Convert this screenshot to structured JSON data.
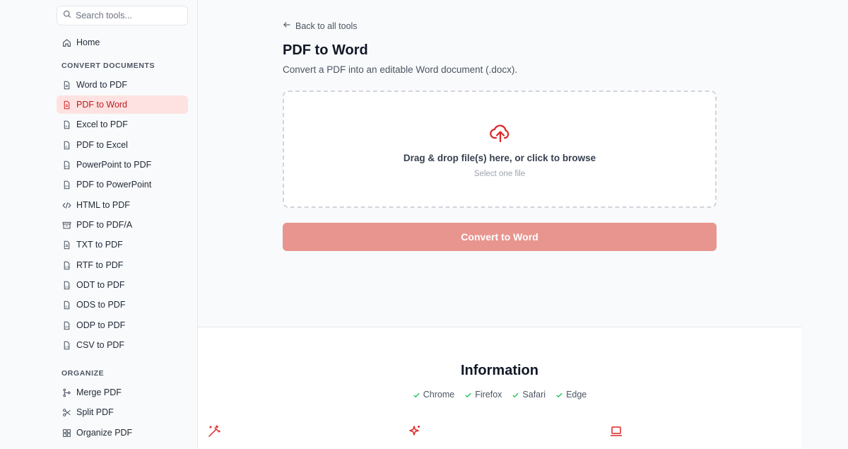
{
  "search": {
    "placeholder": "Search tools..."
  },
  "sidebar": {
    "home": "Home",
    "convert_section": "CONVERT DOCUMENTS",
    "convert_items": [
      "Word to PDF",
      "PDF to Word",
      "Excel to PDF",
      "PDF to Excel",
      "PowerPoint to PDF",
      "PDF to PowerPoint",
      "HTML to PDF",
      "PDF to PDF/A",
      "TXT to PDF",
      "RTF to PDF",
      "ODT to PDF",
      "ODS to PDF",
      "ODP to PDF",
      "CSV to PDF"
    ],
    "organize_section": "ORGANIZE",
    "organize_items": [
      "Merge PDF",
      "Split PDF",
      "Organize PDF"
    ]
  },
  "main": {
    "back": "Back to all tools",
    "title": "PDF to Word",
    "subtitle": "Convert a PDF into an editable Word document (.docx).",
    "drop_text": "Drag & drop file(s) here, or click to browse",
    "drop_hint": "Select one file",
    "convert_label": "Convert to Word"
  },
  "info": {
    "title": "Information",
    "browsers": [
      "Chrome",
      "Firefox",
      "Safari",
      "Edge"
    ]
  },
  "colors": {
    "accent": "#dc2626",
    "active_bg": "#fee2e2",
    "button_disabled": "#e8958f",
    "check": "#22c55e"
  }
}
